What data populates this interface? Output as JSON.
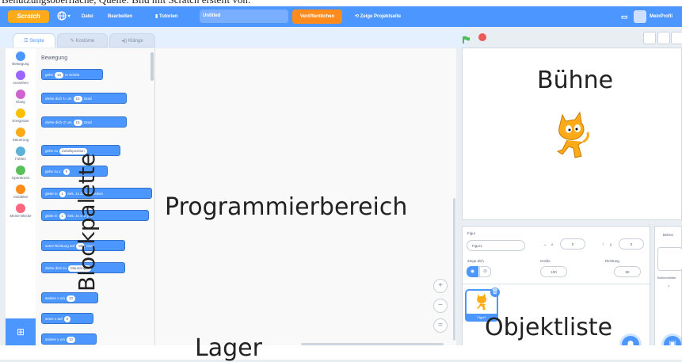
{
  "caption": {
    "text": "Benutzungsoberfläche, Quelle: Bild mit Scratch erstellt von:"
  },
  "menubar": {
    "logo": "Scratch",
    "globe_icon": "globe-icon",
    "file": "Datei",
    "edit": "Bearbeiten",
    "tutorials": "Tutorien",
    "project_title": "Untitled",
    "share": "Veröffentlichen",
    "see_project": "Zeige Projektseite",
    "username": "MeinProfil",
    "accent": "#4c97ff"
  },
  "tabs": [
    {
      "label": "Skripte"
    },
    {
      "label": "Kostüme"
    },
    {
      "label": "Klänge"
    }
  ],
  "categories": [
    {
      "label": "Bewegung",
      "color": "#4c97ff"
    },
    {
      "label": "Aussehen",
      "color": "#9966ff"
    },
    {
      "label": "Klang",
      "color": "#cf63cf"
    },
    {
      "label": "Ereignisse",
      "color": "#ffbf00"
    },
    {
      "label": "Steuerung",
      "color": "#ffab19"
    },
    {
      "label": "Fühlen",
      "color": "#5cb1d6"
    },
    {
      "label": "Operatoren",
      "color": "#59c059"
    },
    {
      "label": "Variablen",
      "color": "#ff8c1a"
    },
    {
      "label": "Meine Blöcke",
      "color": "#ff6680"
    }
  ],
  "palette": {
    "title": "Bewegung",
    "blocks": [
      {
        "pre": "gehe",
        "val": "10",
        "post": "er Schritt"
      },
      {
        "pre": "drehe dich ↻ um",
        "val": "15",
        "post": "Grad"
      },
      {
        "pre": "drehe dich ↺ um",
        "val": "15",
        "post": "Grad"
      },
      {
        "pre": "gehe zu",
        "val": "Zufallsposition",
        "post": ""
      },
      {
        "pre": "gehe zu x:",
        "val": "0",
        "post": ""
      },
      {
        "pre": "gleite in",
        "val": "1",
        "post": "Sek. zu Zufallsposition"
      },
      {
        "pre": "gleite in",
        "val": "1",
        "post": "Sek. zu x: 0 y: 0"
      },
      {
        "pre": "setze Richtung auf",
        "val": "90",
        "post": "Grad"
      },
      {
        "pre": "drehe dich zu",
        "val": "Mauszeiger",
        "post": ""
      },
      {
        "pre": "ändere x um",
        "val": "10",
        "post": ""
      },
      {
        "pre": "setze x auf",
        "val": "0",
        "post": ""
      },
      {
        "pre": "ändere y um",
        "val": "10",
        "post": ""
      }
    ]
  },
  "zoom": {
    "in": "+",
    "out": "−",
    "reset": "="
  },
  "sprite_info": {
    "sprite_label": "Figur",
    "sprite_name": "Figur1",
    "x_label": "x",
    "x_value": "0",
    "y_label": "y",
    "y_value": "0",
    "show_label": "Zeige dich",
    "size_label": "Größe",
    "size_value": "100",
    "direction_label": "Richtung",
    "direction_value": "90"
  },
  "sprite_list": [
    {
      "name": "Figur1"
    }
  ],
  "stage_pane": {
    "title": "Bühne",
    "backdrops_label": "Bühnenbilder",
    "count": "1"
  },
  "overlay_labels": {
    "stage": "Bühne",
    "palette": "Blockpalette",
    "code_area": "Programmierbereich",
    "sprite_list": "Objektliste",
    "backpack": "Lager"
  }
}
